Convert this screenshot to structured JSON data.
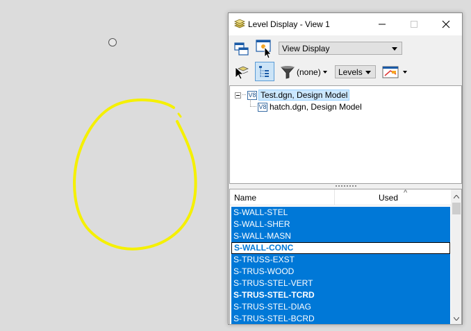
{
  "window": {
    "title": "Level Display - View 1"
  },
  "toolbar": {
    "view_dropdown": "View Display",
    "filter_value": "(none)",
    "levels_dropdown": "Levels"
  },
  "tree": {
    "root_label": "Test.dgn, Design Model",
    "child_label": "hatch.dgn, Design Model",
    "icon_text": "V8"
  },
  "list": {
    "col_name": "Name",
    "col_used": "Used",
    "rows": [
      "S-WALL-STEL",
      "S-WALL-SHER",
      "S-WALL-MASN",
      "S-WALL-CONC",
      "S-TRUSS-EXST",
      "S-TRUS-WOOD",
      "S-TRUS-STEL-VERT",
      "S-TRUS-STEL-TCRD",
      "S-TRUS-STEL-DIAG",
      "S-TRUS-STEL-BCRD"
    ]
  },
  "colors": {
    "selection": "#0078d7",
    "drawing_stroke": "#f5f000",
    "canvas": "#dcdcdc"
  }
}
